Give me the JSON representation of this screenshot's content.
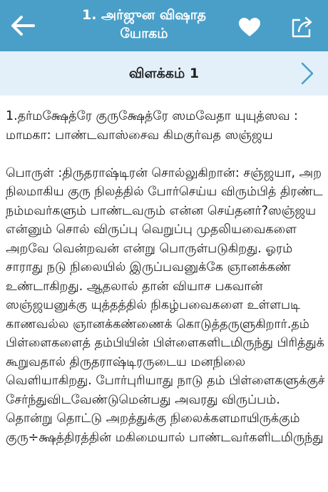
{
  "header": {
    "title_line1": "1. அர்ஜுன விஷாத",
    "title_line2": "யோகம்",
    "back_icon": "arrow-left-icon",
    "favorite_icon": "heart-icon",
    "share_icon": "share-icon",
    "background_color": "#4a9fc8"
  },
  "subheader": {
    "title": "விளக்கம் 1",
    "next_icon": "chevron-right-icon",
    "background_color": "#e3f0fa"
  },
  "content": {
    "verse": "1.தர்மக்ஷேத்ரே குருக்ஷேத்ரே ஸமவேதா யுயுத்ஸவ : மாமகா: பாண்டவாஸ்சைவ கிமகுர்வத ஸஞ்ஜய",
    "meaning": "பொருள் :திருதராஷ்டிரன் சொல்லுகிறான்: சஞ்ஜயா, அற நிலமாகிய குரு நிலத்தில் போர்செய்ய விரும்பித் திரண்ட நம்மவர்களும் பாண்டவரும் என்ன செய்தனர்?ஸஞ்ஜய என்னும் சொல் விருப்பு வெறுப்பு முதலியவைகளை அறவே வென்றவன் என்று பொருள்படுகிறது. ஓரம் சாராது நடு நிலையில் இருப்பவனுக்கே ஞானக்கண் உண்டாகிறது. ஆதலால் தான் வியாச பகவான் ஸஞ்ஜயனுக்கு யுத்தத்தில் நிகழ்பவைகளை உள்ளபடி காணவல்ல ஞானக்கண்ணைக் கொடுத்தருளுகிறார்.தம் பிள்ளைகளைத் தம்பியின் பிள்ளைகளிடமிருந்து பிரித்துக் கூறுவதால் திருதராஷ்டிரருடைய மனநிலை வெளியாகிறது. போர்புரியாது நாடு தம் பிள்ளைகளுக்குச் சேர்ந்துவிடவேண்டுமென்பது அவரது விருப்பம். தொன்று தொட்டு அறத்துக்கு நிலைக்களமாயிருக்கும் குரு÷க்ஷத்திரத்தின் மகிமையால் பாண்டவர்களிடமிருந்து"
  }
}
